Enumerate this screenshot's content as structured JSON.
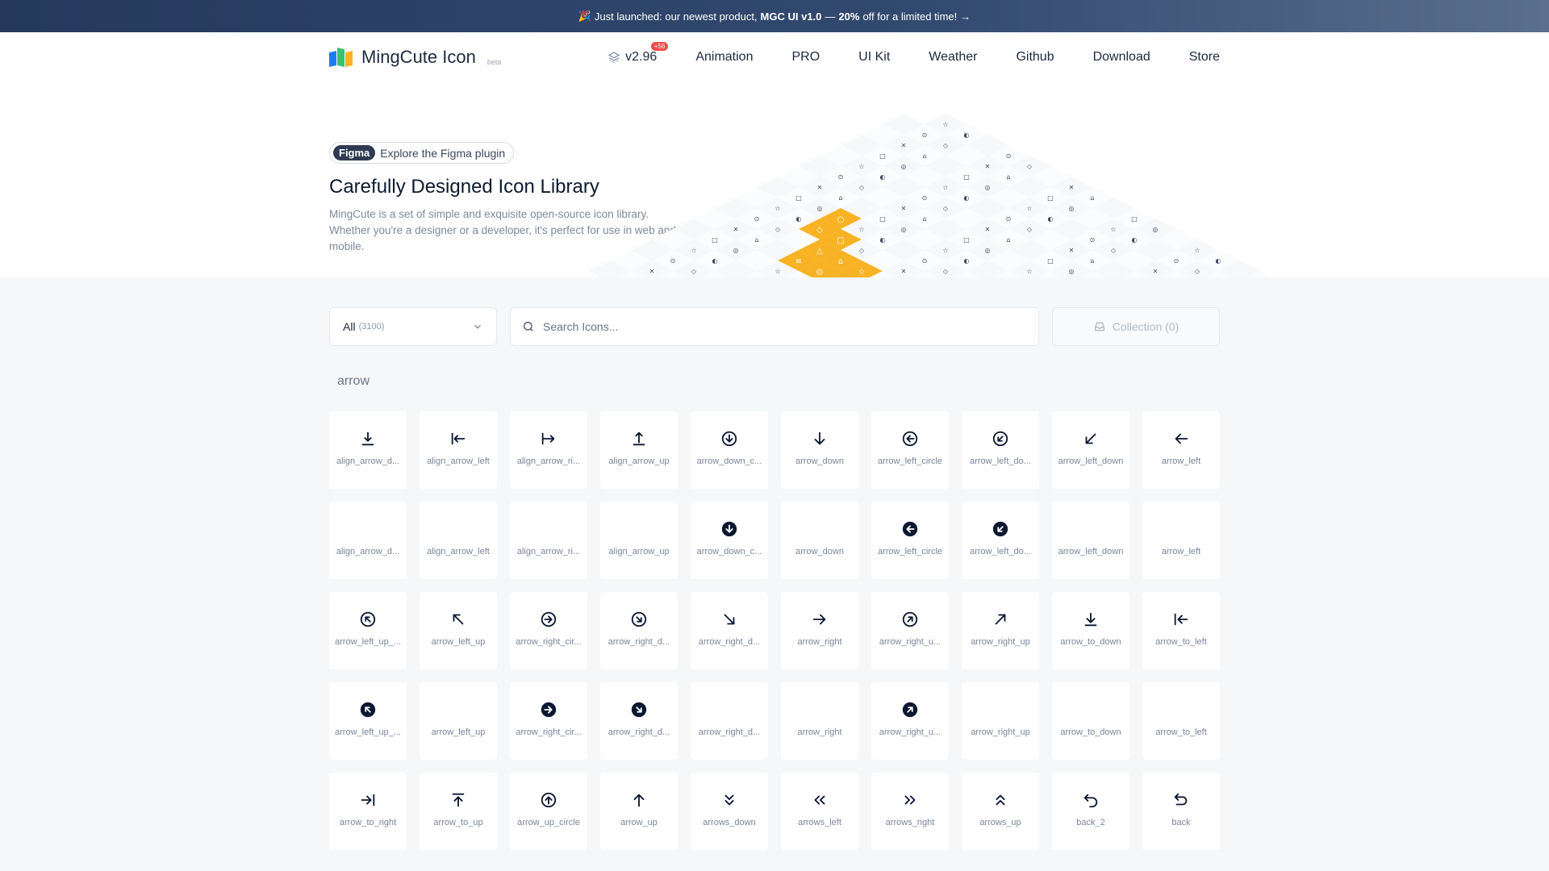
{
  "banner": {
    "emoji": "🎉",
    "pre": "Just launched: our newest product,",
    "product": "MGC UI v1.0",
    "dash": "—",
    "discount": "20%",
    "post": "off for a limited time!",
    "arrow": "→"
  },
  "nav": {
    "logo_title": "MingCute Icon",
    "logo_beta": "beta",
    "version": "v2.96",
    "version_badge": "+56",
    "links": [
      "Animation",
      "PRO",
      "UI Kit",
      "Weather",
      "Github",
      "Download",
      "Store"
    ]
  },
  "hero": {
    "figma_tag": "Figma",
    "figma_text": "Explore the Figma plugin",
    "title": "Carefully Designed Icon Library",
    "description": "MingCute is a set of simple and exquisite open-source icon library. Whether you're a designer or a developer, it's perfect for use in web and mobile."
  },
  "toolbar": {
    "select_value": "All",
    "select_count": "(3100)",
    "search_placeholder": "Search Icons...",
    "collection_label": "Collection (0)"
  },
  "section": {
    "label": "arrow"
  },
  "icons": [
    {
      "name": "align_arrow_d...",
      "icon": "align-arrow-down-icon"
    },
    {
      "name": "align_arrow_left",
      "icon": "align-arrow-left-icon"
    },
    {
      "name": "align_arrow_ri...",
      "icon": "align-arrow-right-icon"
    },
    {
      "name": "align_arrow_up",
      "icon": "align-arrow-up-icon"
    },
    {
      "name": "arrow_down_c...",
      "icon": "arrow-down-circle-icon"
    },
    {
      "name": "arrow_down",
      "icon": "arrow-down-icon"
    },
    {
      "name": "arrow_left_circle",
      "icon": "arrow-left-circle-icon"
    },
    {
      "name": "arrow_left_do...",
      "icon": "arrow-left-down-circle-icon"
    },
    {
      "name": "arrow_left_down",
      "icon": "arrow-left-down-icon"
    },
    {
      "name": "arrow_left",
      "icon": "arrow-left-icon"
    },
    {
      "name": "align_arrow_d...",
      "icon": "align-arrow-down-fill-icon"
    },
    {
      "name": "align_arrow_left",
      "icon": "align-arrow-left-fill-icon"
    },
    {
      "name": "align_arrow_ri...",
      "icon": "align-arrow-right-fill-icon"
    },
    {
      "name": "align_arrow_up",
      "icon": "align-arrow-up-fill-icon"
    },
    {
      "name": "arrow_down_c...",
      "icon": "arrow-down-circle-fill-icon"
    },
    {
      "name": "arrow_down",
      "icon": "arrow-down-fill-icon"
    },
    {
      "name": "arrow_left_circle",
      "icon": "arrow-left-circle-fill-icon"
    },
    {
      "name": "arrow_left_do...",
      "icon": "arrow-left-down-circle-fill-icon"
    },
    {
      "name": "arrow_left_down",
      "icon": "arrow-left-down-fill-icon"
    },
    {
      "name": "arrow_left",
      "icon": "arrow-left-fill-icon"
    },
    {
      "name": "arrow_left_up_...",
      "icon": "arrow-left-up-circle-icon"
    },
    {
      "name": "arrow_left_up",
      "icon": "arrow-left-up-icon"
    },
    {
      "name": "arrow_right_cir...",
      "icon": "arrow-right-circle-icon"
    },
    {
      "name": "arrow_right_d...",
      "icon": "arrow-right-down-circle-icon"
    },
    {
      "name": "arrow_right_d...",
      "icon": "arrow-right-down-icon"
    },
    {
      "name": "arrow_right",
      "icon": "arrow-right-icon"
    },
    {
      "name": "arrow_right_u...",
      "icon": "arrow-right-up-circle-icon"
    },
    {
      "name": "arrow_right_up",
      "icon": "arrow-right-up-icon"
    },
    {
      "name": "arrow_to_down",
      "icon": "arrow-to-down-icon"
    },
    {
      "name": "arrow_to_left",
      "icon": "arrow-to-left-icon"
    },
    {
      "name": "arrow_left_up_...",
      "icon": "arrow-left-up-circle-fill-icon"
    },
    {
      "name": "arrow_left_up",
      "icon": "arrow-left-up-fill-icon"
    },
    {
      "name": "arrow_right_cir...",
      "icon": "arrow-right-circle-fill-icon"
    },
    {
      "name": "arrow_right_d...",
      "icon": "arrow-right-down-circle-fill-icon"
    },
    {
      "name": "arrow_right_d...",
      "icon": "arrow-right-down-fill-icon"
    },
    {
      "name": "arrow_right",
      "icon": "arrow-right-fill-icon"
    },
    {
      "name": "arrow_right_u...",
      "icon": "arrow-right-up-circle-fill-icon"
    },
    {
      "name": "arrow_right_up",
      "icon": "arrow-right-up-fill-icon"
    },
    {
      "name": "arrow_to_down",
      "icon": "arrow-to-down-fill-icon"
    },
    {
      "name": "arrow_to_left",
      "icon": "arrow-to-left-fill-icon"
    },
    {
      "name": "arrow_to_right",
      "icon": "arrow-to-right-icon"
    },
    {
      "name": "arrow_to_up",
      "icon": "arrow-to-up-icon"
    },
    {
      "name": "arrow_up_circle",
      "icon": "arrow-up-circle-icon"
    },
    {
      "name": "arrow_up",
      "icon": "arrow-up-icon"
    },
    {
      "name": "arrows_down",
      "icon": "arrows-down-icon"
    },
    {
      "name": "arrows_left",
      "icon": "arrows-left-icon"
    },
    {
      "name": "arrows_right",
      "icon": "arrows-right-icon"
    },
    {
      "name": "arrows_up",
      "icon": "arrows-up-icon"
    },
    {
      "name": "back_2",
      "icon": "back-2-icon"
    },
    {
      "name": "back",
      "icon": "back-icon"
    }
  ],
  "colors": {
    "banner_start": "#24395c",
    "banner_end": "#5a6f8f",
    "iso_blue": "#2f7cf6",
    "iso_green": "#34c370",
    "iso_orange": "#f7b324",
    "badge_red": "#ef4a4a"
  }
}
